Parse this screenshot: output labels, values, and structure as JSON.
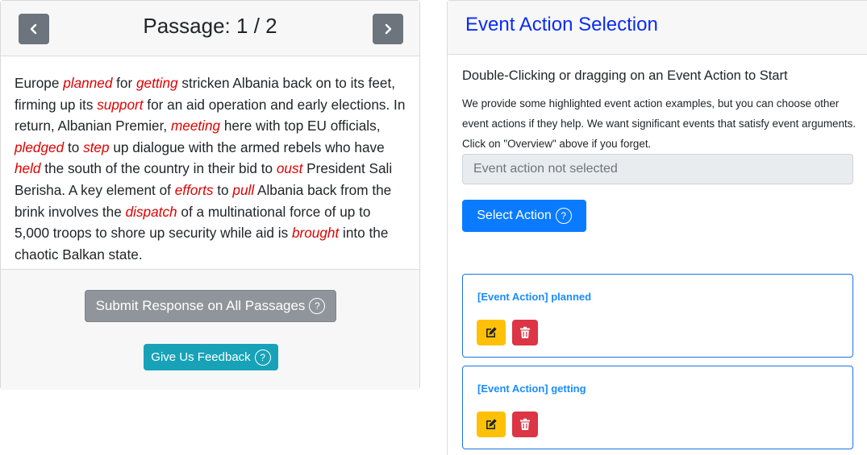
{
  "passage_panel": {
    "title": "Passage: 1 / 2",
    "text_segments": [
      {
        "text": "Europe ",
        "highlight": false
      },
      {
        "text": "planned",
        "highlight": true
      },
      {
        "text": " for ",
        "highlight": false
      },
      {
        "text": "getting",
        "highlight": true
      },
      {
        "text": " stricken Albania back on to its feet, firming up its ",
        "highlight": false
      },
      {
        "text": "support",
        "highlight": true
      },
      {
        "text": " for an aid operation and early elections. In return, Albanian Premier, ",
        "highlight": false
      },
      {
        "text": "meeting",
        "highlight": true
      },
      {
        "text": " here with top EU officials, ",
        "highlight": false
      },
      {
        "text": "pledged",
        "highlight": true
      },
      {
        "text": " to ",
        "highlight": false
      },
      {
        "text": "step",
        "highlight": true
      },
      {
        "text": " up dialogue with the armed rebels who have ",
        "highlight": false
      },
      {
        "text": "held",
        "highlight": true
      },
      {
        "text": " the south of the country in their bid to ",
        "highlight": false
      },
      {
        "text": "oust",
        "highlight": true
      },
      {
        "text": " President Sali Berisha. A key element of ",
        "highlight": false
      },
      {
        "text": "efforts",
        "highlight": true
      },
      {
        "text": " to ",
        "highlight": false
      },
      {
        "text": "pull",
        "highlight": true
      },
      {
        "text": " Albania back from the brink involves the ",
        "highlight": false
      },
      {
        "text": "dispatch",
        "highlight": true
      },
      {
        "text": " of a multinational force of up to 5,000 troops to shore up security while aid is ",
        "highlight": false
      },
      {
        "text": "brought",
        "highlight": true
      },
      {
        "text": " into the chaotic Balkan state.",
        "highlight": false
      }
    ],
    "submit_label": "Submit Response on All Passages",
    "feedback_label": "Give Us Feedback",
    "help_glyph": "?"
  },
  "event_panel": {
    "title": "Event Action Selection",
    "instruction_heading": "Double-Clicking or dragging on an Event Action to Start",
    "instruction_text": "We provide some highlighted event action examples, but you can choose other event actions if they help. We want significant events that satisfy event arguments. Click on \"Overview\" above if you forget.",
    "event_field_placeholder": "Event action not selected",
    "select_label": "Select Action",
    "help_glyph": "?",
    "events": [
      {
        "label": "[Event Action] planned"
      },
      {
        "label": "[Event Action] getting"
      }
    ]
  },
  "colors": {
    "highlight": "#e00000",
    "title_blue": "#0a2cf5",
    "primary": "#0a7bff",
    "info": "#17a2b8",
    "secondary": "#8f959a",
    "warning": "#ffc107",
    "danger": "#dc3545"
  },
  "icons": {
    "prev": "chevron-left-icon",
    "next": "chevron-right-icon",
    "help": "question-circle-icon",
    "edit": "edit-icon",
    "delete": "trash-icon"
  }
}
